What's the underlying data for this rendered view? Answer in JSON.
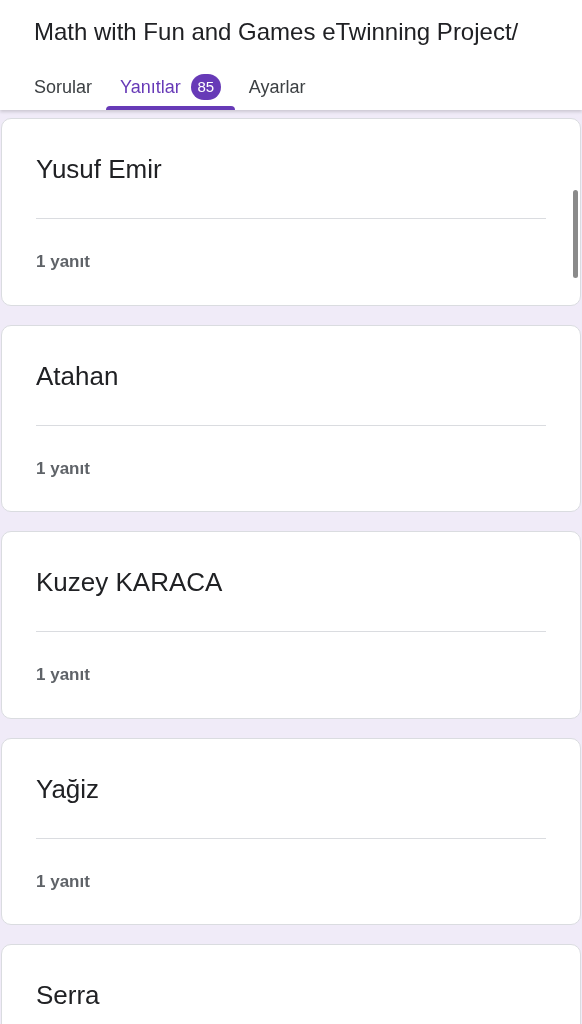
{
  "form_title": "Math with Fun and Games eTwinning Project/",
  "tabs": [
    {
      "label": "Sorular",
      "selected": false
    },
    {
      "label": "Yanıtlar",
      "selected": true,
      "count": "85"
    },
    {
      "label": "Ayarlar",
      "selected": false
    }
  ],
  "responses": [
    {
      "title": "Yusuf Emir",
      "summary": "1 yanıt"
    },
    {
      "title": "Atahan",
      "summary": "1 yanıt"
    },
    {
      "title": "Kuzey KARACA",
      "summary": "1 yanıt"
    },
    {
      "title": "Yağiz",
      "summary": "1 yanıt"
    },
    {
      "title": "Serra"
    }
  ]
}
